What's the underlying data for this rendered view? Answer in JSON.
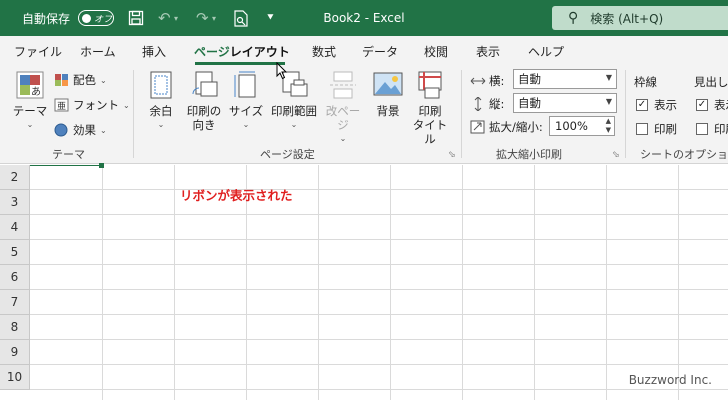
{
  "titlebar": {
    "autosave_label": "自動保存",
    "autosave_state": "オフ",
    "doc_title": "Book2  -  Excel",
    "search_placeholder": "検索 (Alt+Q)",
    "accent": "#217346"
  },
  "tabs": [
    {
      "label": "ファイル"
    },
    {
      "label": "ホーム"
    },
    {
      "label": "挿入"
    },
    {
      "label_part1": "ページ",
      "label_part2": "レイアウト",
      "active": true
    },
    {
      "label": "数式"
    },
    {
      "label": "データ"
    },
    {
      "label": "校閲"
    },
    {
      "label": "表示"
    },
    {
      "label": "ヘルプ"
    }
  ],
  "ribbon": {
    "theme_group": {
      "label": "テーマ",
      "themes_button": "テーマ",
      "colors": "配色",
      "fonts": "フォント",
      "effects": "効果"
    },
    "page_setup_group": {
      "label": "ページ設定",
      "margins": "余白",
      "orientation_1": "印刷の",
      "orientation_2": "向き",
      "size": "サイズ",
      "print_area": "印刷範囲",
      "breaks": "改ページ",
      "background": "背景",
      "print_titles_1": "印刷",
      "print_titles_2": "タイトル"
    },
    "scale_group": {
      "label": "拡大縮小印刷",
      "width_label": "横:",
      "width_value": "自動",
      "height_label": "縦:",
      "height_value": "自動",
      "scale_label": "拡大/縮小:",
      "scale_value": "100%"
    },
    "sheet_options_group": {
      "label": "シートのオプション",
      "gridlines": "枠線",
      "headings": "見出し",
      "view": "表示",
      "print": "印刷"
    }
  },
  "sheet": {
    "rows": [
      "2",
      "3",
      "4",
      "5",
      "6",
      "7",
      "8",
      "9",
      "10"
    ],
    "annotation": "リボンが表示された",
    "watermark": "Buzzword Inc."
  }
}
